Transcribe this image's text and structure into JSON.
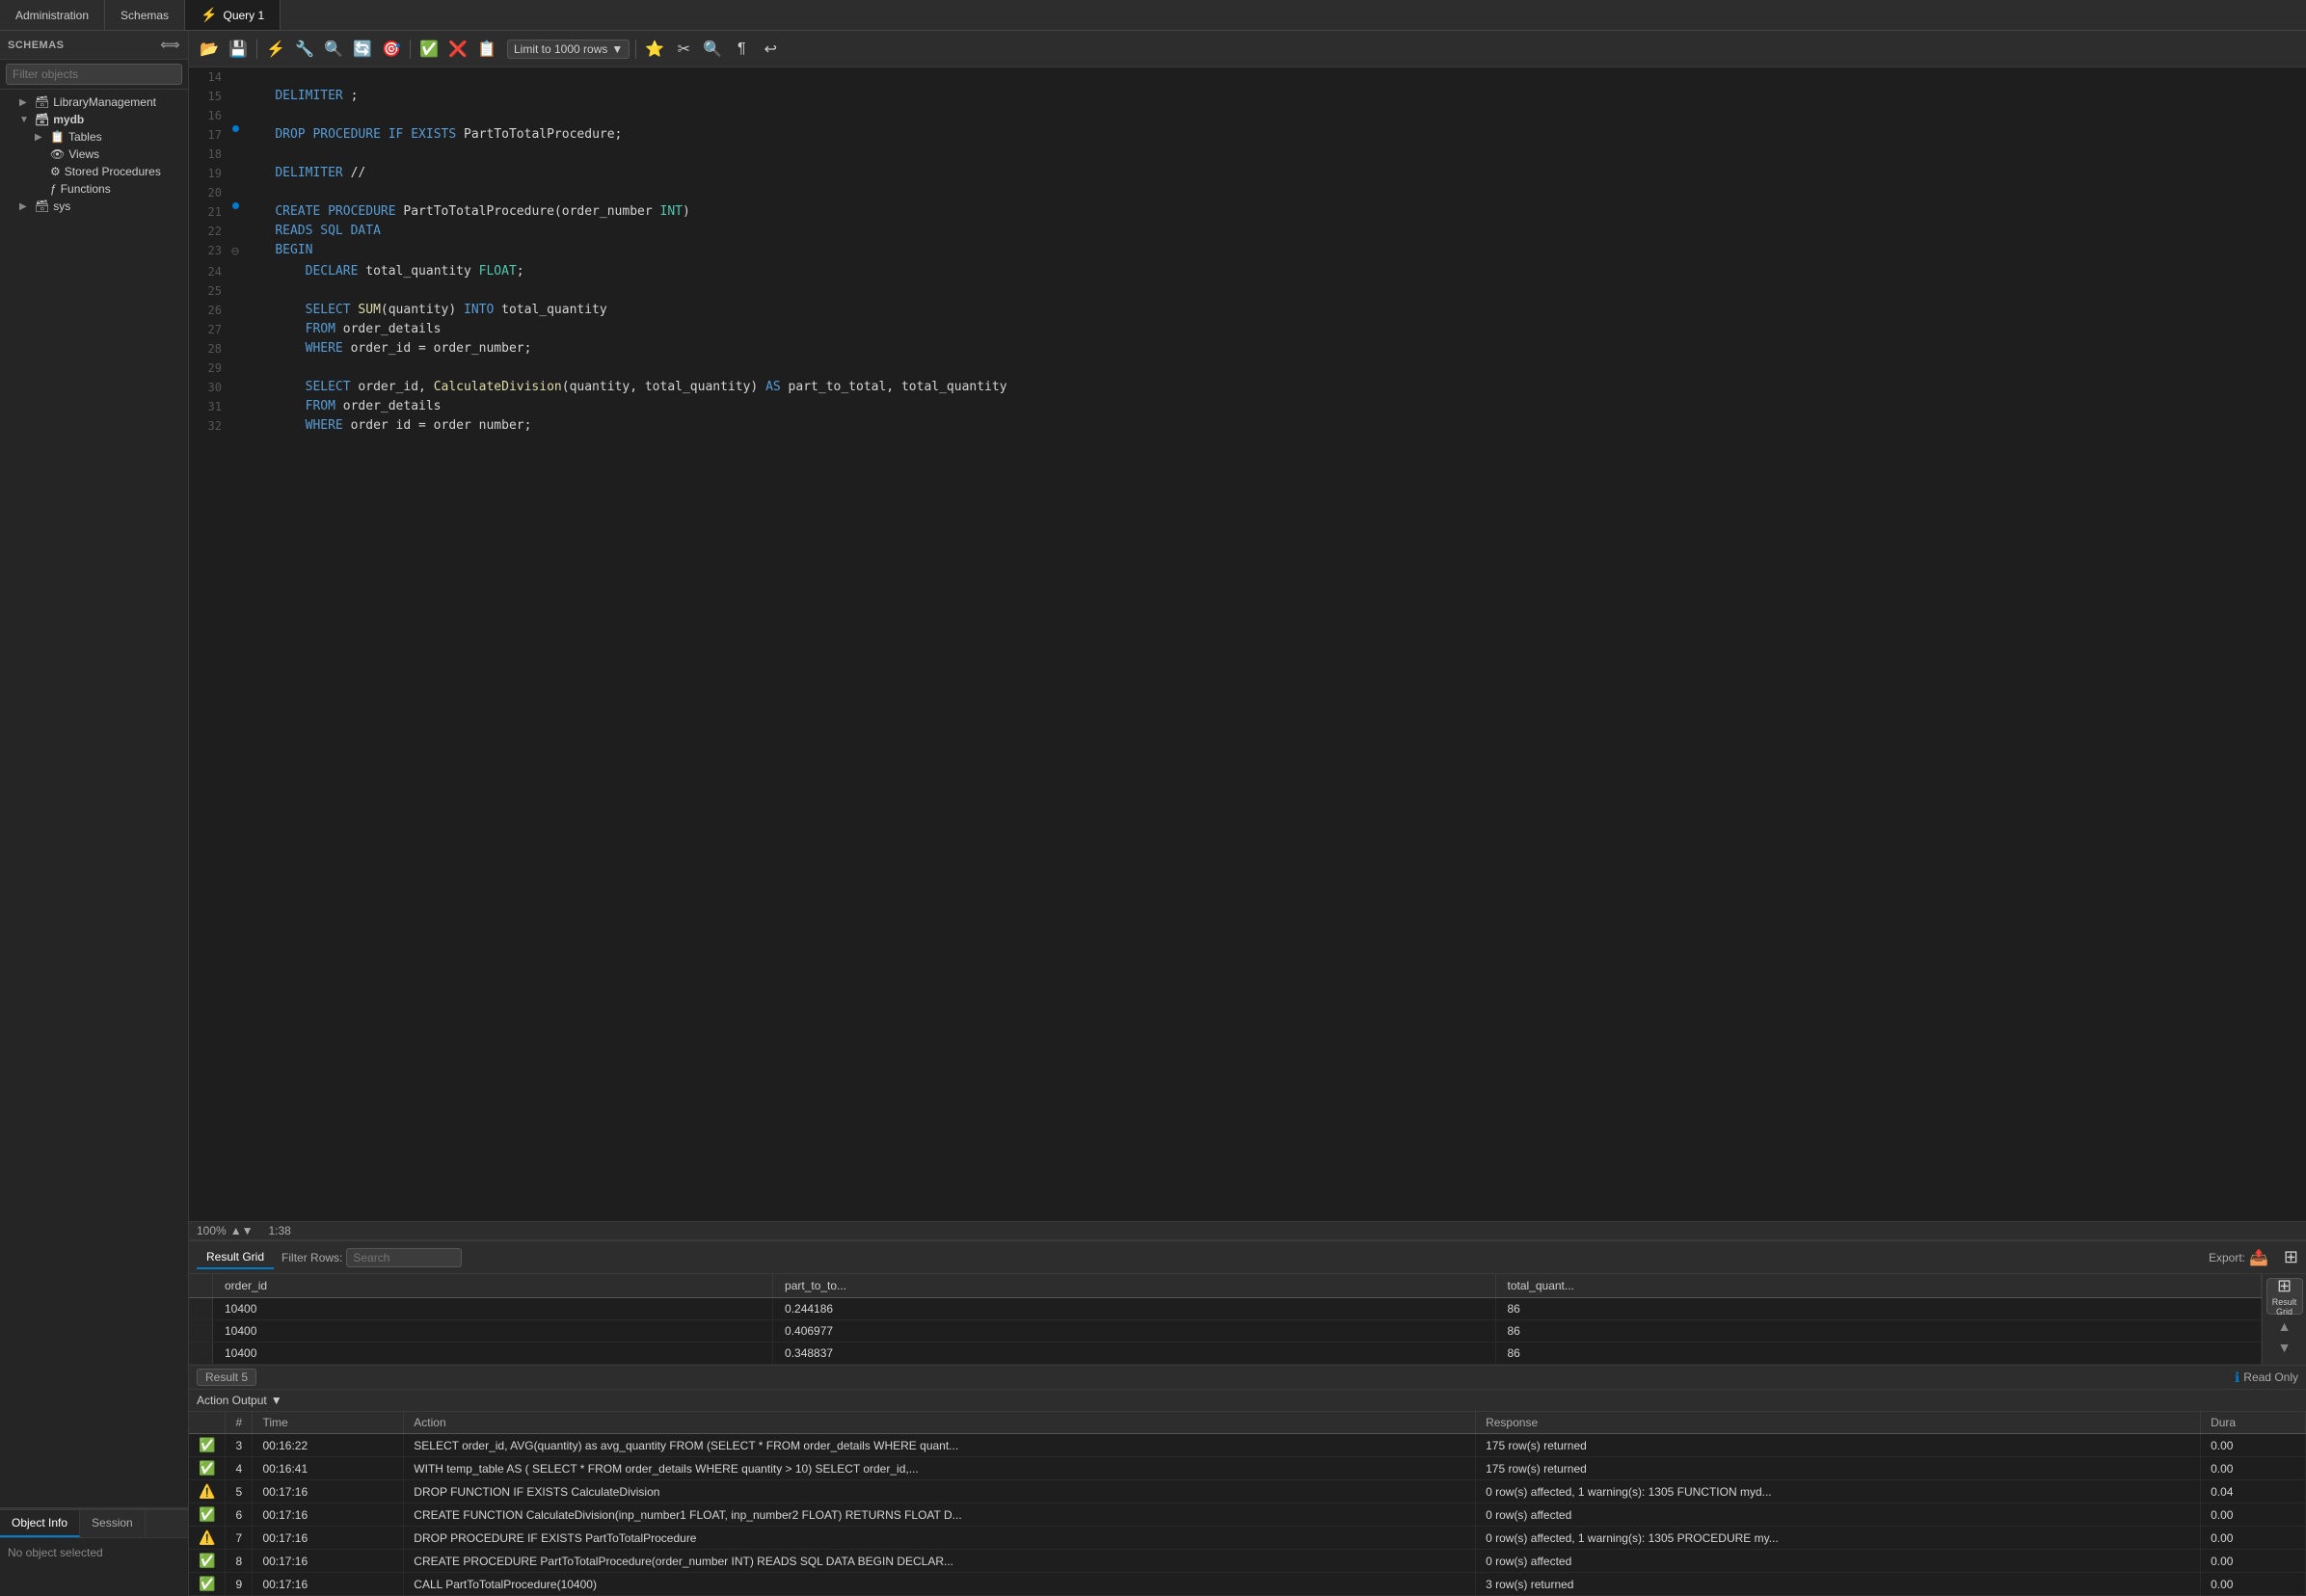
{
  "tabs": [
    {
      "id": "administration",
      "label": "Administration",
      "active": false
    },
    {
      "id": "schemas",
      "label": "Schemas",
      "active": false
    },
    {
      "id": "query1",
      "label": "Query 1",
      "active": true,
      "icon": "⚡"
    }
  ],
  "sidebar": {
    "header": "SCHEMAS",
    "filter_placeholder": "Filter objects",
    "tree": [
      {
        "id": "libmgmt",
        "level": 1,
        "label": "LibraryManagement",
        "icon": "🗃",
        "expand": "▶",
        "expanded": false
      },
      {
        "id": "mydb",
        "level": 1,
        "label": "mydb",
        "icon": "🗃",
        "expand": "▼",
        "expanded": true,
        "bold": true
      },
      {
        "id": "tables",
        "level": 2,
        "label": "Tables",
        "icon": "📋",
        "expand": "▶"
      },
      {
        "id": "views",
        "level": 2,
        "label": "Views",
        "icon": "👁",
        "expand": ""
      },
      {
        "id": "storedprocs",
        "level": 2,
        "label": "Stored Procedures",
        "icon": "⚙",
        "expand": ""
      },
      {
        "id": "functions",
        "level": 2,
        "label": "Functions",
        "icon": "ƒ",
        "expand": ""
      },
      {
        "id": "sys",
        "level": 1,
        "label": "sys",
        "icon": "🗃",
        "expand": "▶",
        "expanded": false
      }
    ]
  },
  "sidebar_bottom": {
    "tabs": [
      "Object Info",
      "Session"
    ],
    "active_tab": "Object Info",
    "content": "No object selected"
  },
  "toolbar": {
    "limit_label": "Limit to 1000 rows",
    "buttons": [
      "📂",
      "💾",
      "⚡",
      "🔧",
      "🔍",
      "🔄",
      "🎯",
      "✅",
      "❌",
      "📋"
    ]
  },
  "editor": {
    "zoom": "100%",
    "cursor_pos": "1:38",
    "lines": [
      {
        "num": 14,
        "dot": false,
        "content": ""
      },
      {
        "num": 15,
        "dot": false,
        "content": "    DELIMITER ;"
      },
      {
        "num": 16,
        "dot": false,
        "content": ""
      },
      {
        "num": 17,
        "dot": true,
        "content": "    DROP PROCEDURE IF EXISTS PartToTotalProcedure;"
      },
      {
        "num": 18,
        "dot": false,
        "content": ""
      },
      {
        "num": 19,
        "dot": false,
        "content": "    DELIMITER //"
      },
      {
        "num": 20,
        "dot": false,
        "content": ""
      },
      {
        "num": 21,
        "dot": true,
        "content": "    CREATE PROCEDURE PartToTotalProcedure(order_number INT)"
      },
      {
        "num": 22,
        "dot": false,
        "content": "    READS SQL DATA"
      },
      {
        "num": 23,
        "dot": false,
        "content": "    BEGIN",
        "collapse": true
      },
      {
        "num": 24,
        "dot": false,
        "content": "        DECLARE total_quantity FLOAT;"
      },
      {
        "num": 25,
        "dot": false,
        "content": ""
      },
      {
        "num": 26,
        "dot": false,
        "content": "        SELECT SUM(quantity) INTO total_quantity"
      },
      {
        "num": 27,
        "dot": false,
        "content": "        FROM order_details"
      },
      {
        "num": 28,
        "dot": false,
        "content": "        WHERE order_id = order_number;"
      },
      {
        "num": 29,
        "dot": false,
        "content": ""
      },
      {
        "num": 30,
        "dot": false,
        "content": "        SELECT order_id, CalculateDivision(quantity, total_quantity) AS part_to_total, total_quantity"
      },
      {
        "num": 31,
        "dot": false,
        "content": "        FROM order_details"
      },
      {
        "num": 32,
        "dot": false,
        "content": "        WHERE order id = order number;"
      }
    ]
  },
  "result": {
    "tabs": [
      "Result Grid",
      "Filter Rows:",
      "Export:"
    ],
    "active_tab": "Result Grid",
    "filter_placeholder": "Search",
    "columns": [
      "order_id",
      "part_to_to...",
      "total_quant..."
    ],
    "rows": [
      {
        "order_id": "10400",
        "part_to_to": "0.244186",
        "total_quant": "86"
      },
      {
        "order_id": "10400",
        "part_to_to": "0.406977",
        "total_quant": "86"
      },
      {
        "order_id": "10400",
        "part_to_to": "0.348837",
        "total_quant": "86"
      }
    ],
    "result_count": "Result 5",
    "readonly": "Read Only"
  },
  "action_output": {
    "label": "Action Output",
    "columns": [
      "",
      "Time",
      "Action",
      "Response",
      "Dura"
    ],
    "rows": [
      {
        "status": "ok",
        "num": "3",
        "time": "00:16:22",
        "action": "SELECT order_id, AVG(quantity) as avg_quantity FROM (SELECT * FROM order_details WHERE quant...",
        "response": "175 row(s) returned",
        "duration": "0.00"
      },
      {
        "status": "ok",
        "num": "4",
        "time": "00:16:41",
        "action": "WITH temp_table AS (  SELECT *     FROM order_details     WHERE quantity > 10) SELECT order_id,...",
        "response": "175 row(s) returned",
        "duration": "0.00"
      },
      {
        "status": "warn",
        "num": "5",
        "time": "00:17:16",
        "action": "DROP FUNCTION IF EXISTS CalculateDivision",
        "response": "0 row(s) affected, 1 warning(s): 1305 FUNCTION myd...",
        "duration": "0.04"
      },
      {
        "status": "ok",
        "num": "6",
        "time": "00:17:16",
        "action": "CREATE FUNCTION CalculateDivision(inp_number1 FLOAT, inp_number2 FLOAT) RETURNS FLOAT D...",
        "response": "0 row(s) affected",
        "duration": "0.00"
      },
      {
        "status": "warn",
        "num": "7",
        "time": "00:17:16",
        "action": "DROP PROCEDURE IF EXISTS PartToTotalProcedure",
        "response": "0 row(s) affected, 1 warning(s): 1305 PROCEDURE my...",
        "duration": "0.00"
      },
      {
        "status": "ok",
        "num": "8",
        "time": "00:17:16",
        "action": "CREATE PROCEDURE PartToTotalProcedure(order_number INT) READS SQL DATA BEGIN    DECLAR...",
        "response": "0 row(s) affected",
        "duration": "0.00"
      },
      {
        "status": "ok",
        "num": "9",
        "time": "00:17:16",
        "action": "CALL PartToTotalProcedure(10400)",
        "response": "3 row(s) returned",
        "duration": "0.00"
      }
    ]
  },
  "right_panel": {
    "btn_label": "Result\nGrid",
    "btn_icon": "⊞"
  },
  "colors": {
    "accent": "#007acc",
    "bg_dark": "#1e1e1e",
    "bg_sidebar": "#252526",
    "bg_toolbar": "#2d2d2d",
    "keyword_blue": "#569cd6",
    "keyword_cyan": "#4ec9b0",
    "text_normal": "#d4d4d4"
  }
}
